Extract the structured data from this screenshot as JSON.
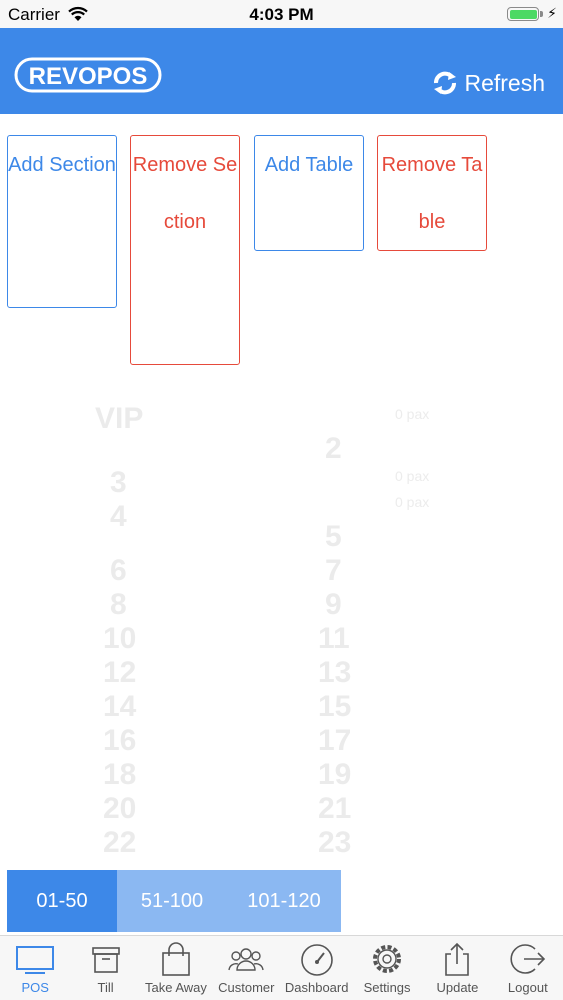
{
  "status_bar": {
    "carrier": "Carrier",
    "time": "4:03 PM"
  },
  "header": {
    "logo_text": "REVOPOS",
    "refresh_label": "Refresh"
  },
  "actions": {
    "add_section": "Add Section",
    "remove_section": "Remove Section",
    "add_table": "Add Table",
    "remove_table": "Remove Table"
  },
  "layout_preview": {
    "section_label": "VIP",
    "tables": [
      "2",
      "3",
      "4",
      "5",
      "6",
      "7",
      "8",
      "9",
      "10",
      "11",
      "12",
      "13",
      "14",
      "15",
      "16",
      "17",
      "18",
      "19",
      "20",
      "21",
      "22",
      "23"
    ],
    "side_notes": [
      "0 pax",
      "0 pax",
      "0 pax"
    ]
  },
  "range_tabs": [
    "01-50",
    "51-100",
    "101-120"
  ],
  "tabbar": {
    "items": [
      "POS",
      "Till",
      "Take Away",
      "Customer",
      "Dashboard",
      "Settings",
      "Update",
      "Logout"
    ],
    "active": "POS"
  },
  "colors": {
    "brand": "#3d88e8",
    "danger": "#e64a3b",
    "battery": "#4cd964"
  }
}
